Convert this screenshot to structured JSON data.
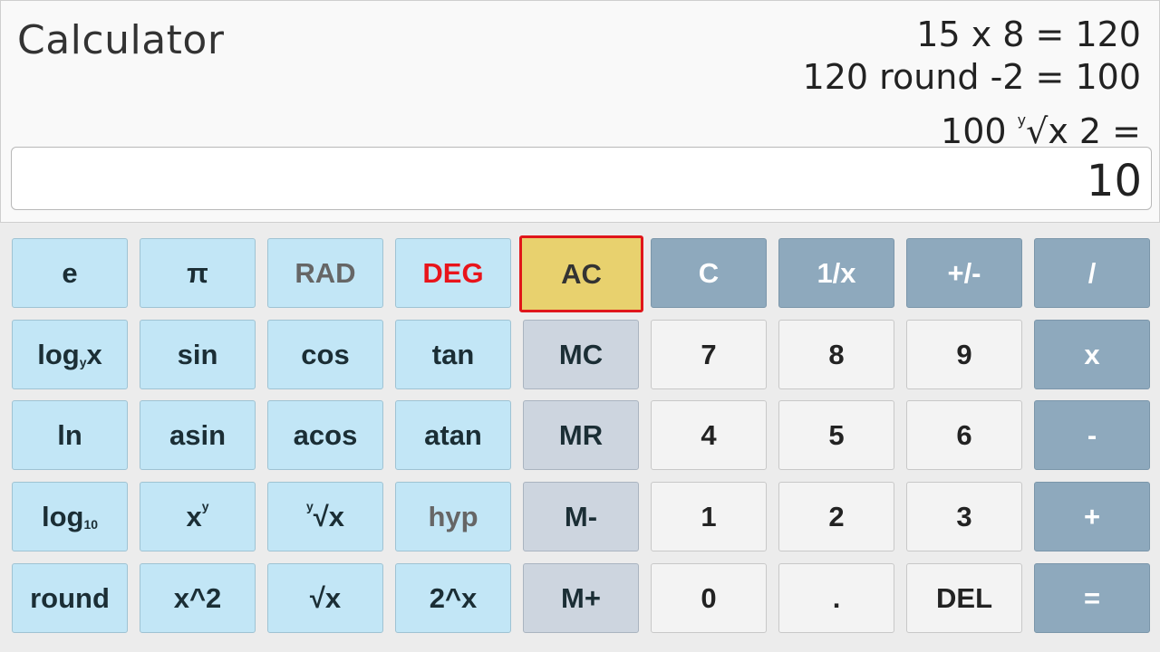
{
  "app": {
    "title": "Calculator"
  },
  "history": {
    "line1": "15 x 8 = 120",
    "line2": "120 round -2 = 100",
    "line3_pre": "100 ",
    "line3_sup": "y",
    "line3_post": "√x 2 ="
  },
  "display": {
    "value": "10"
  },
  "keys": {
    "e": "e",
    "pi": "π",
    "rad": "RAD",
    "deg": "DEG",
    "ac": "AC",
    "c": "C",
    "reciprocal": "1/x",
    "negate": "+/-",
    "divide": "/",
    "logyx_base": "log",
    "logyx_sub": "y",
    "logyx_tail": "x",
    "sin": "sin",
    "cos": "cos",
    "tan": "tan",
    "mc": "MC",
    "seven": "7",
    "eight": "8",
    "nine": "9",
    "multiply": "x",
    "ln": "ln",
    "asin": "asin",
    "acos": "acos",
    "atan": "atan",
    "mr": "MR",
    "four": "4",
    "five": "5",
    "six": "6",
    "subtract": "-",
    "log10_base": "log",
    "log10_sub": "10",
    "power_base": "x",
    "power_sup": "y",
    "yroot_sup": "y",
    "yroot_tail": "√x",
    "hyp": "hyp",
    "mminus": "M-",
    "one": "1",
    "two": "2",
    "three": "3",
    "add": "+",
    "round": "round",
    "square": "x^2",
    "sqrt": "√x",
    "two_pow_x": "2^x",
    "mplus": "M+",
    "zero": "0",
    "decimal": ".",
    "del": "DEL",
    "equals": "="
  },
  "colors": {
    "scientific_key": "#c2e6f6",
    "memory_key": "#cdd5df",
    "number_key": "#f3f3f3",
    "operator_key": "#8ea9bd",
    "ac_key": "#e8d16e",
    "ac_border": "#e0161a",
    "deg_text": "#e8141b"
  }
}
